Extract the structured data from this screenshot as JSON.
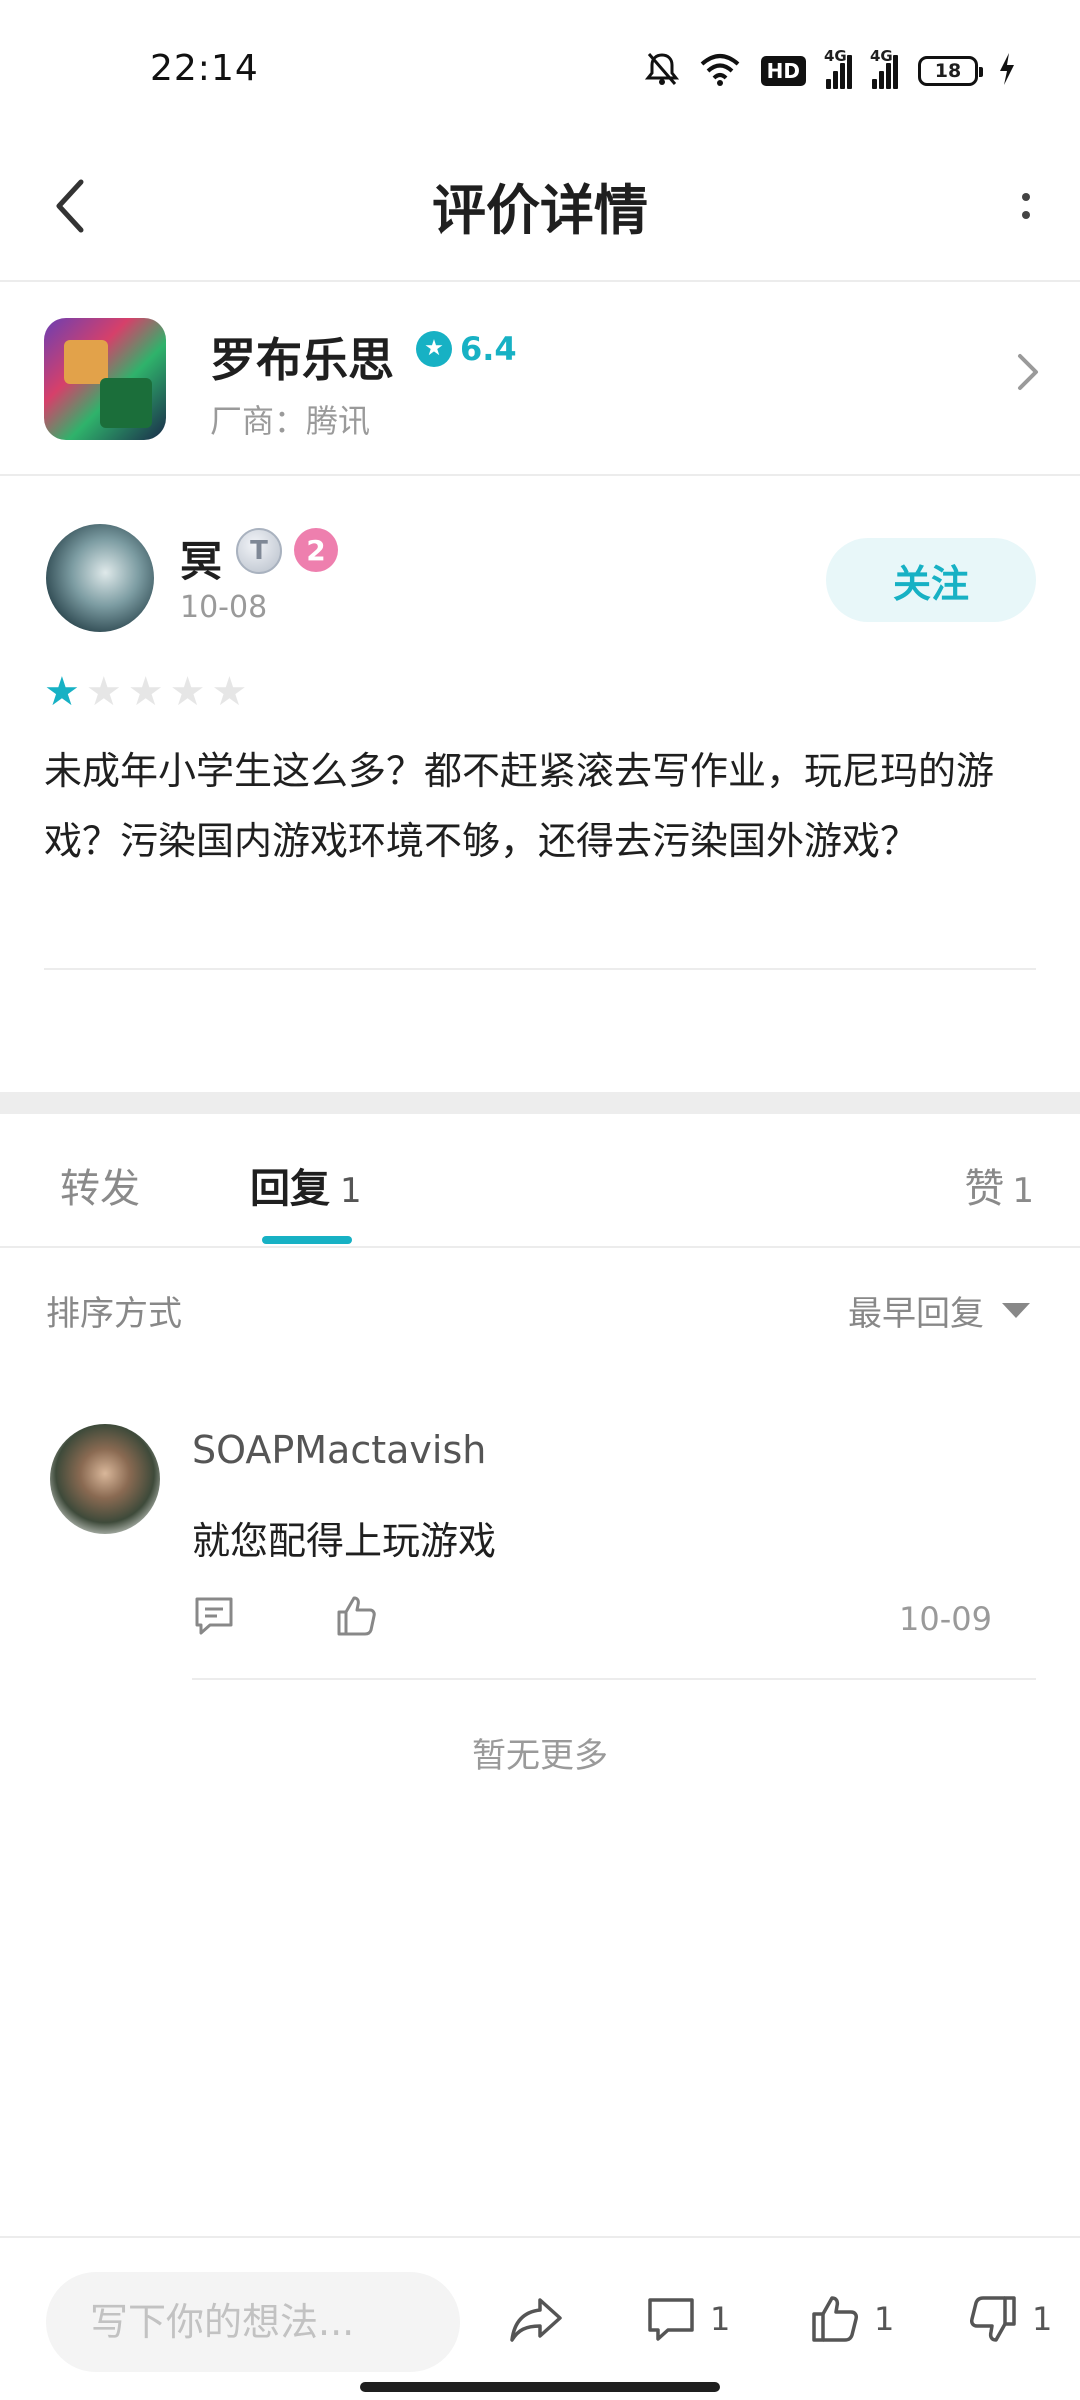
{
  "status_bar": {
    "time": "22:14",
    "hd_label": "HD",
    "signal_label": "4G",
    "battery_level": "18",
    "icons": [
      "mute-bell-icon",
      "wifi-icon",
      "hd-icon",
      "signal-icon",
      "signal-icon",
      "battery-icon",
      "charging-icon"
    ]
  },
  "nav": {
    "title": "评价详情",
    "back_icon": "chevron-left-icon",
    "more_icon": "more-vertical-icon"
  },
  "app": {
    "name": "罗布乐思",
    "rating": "6.4",
    "vendor": "厂商：腾讯",
    "accent": "#17b1c4"
  },
  "review": {
    "user_name": "冥",
    "level_badge": "T",
    "badge_number": "2",
    "date": "10-08",
    "follow_label": "关注",
    "stars": 1,
    "stars_max": 5,
    "text": "未成年小学生这么多？都不赶紧滚去写作业，玩尼玛的游戏？污染国内游戏环境不够，还得去污染国外游戏？"
  },
  "tabs": {
    "forward": "转发",
    "reply": "回复",
    "reply_count": "1",
    "like": "赞",
    "like_count": "1"
  },
  "sort": {
    "label": "排序方式",
    "selected": "最早回复"
  },
  "comments": [
    {
      "user": "SOAPMactavish",
      "text": "就您配得上玩游戏",
      "date": "10-09"
    }
  ],
  "no_more": "暂无更多",
  "bottom_bar": {
    "input_placeholder": "写下你的想法...",
    "comment_count": "1",
    "like_count": "1",
    "dislike_count": "1"
  }
}
